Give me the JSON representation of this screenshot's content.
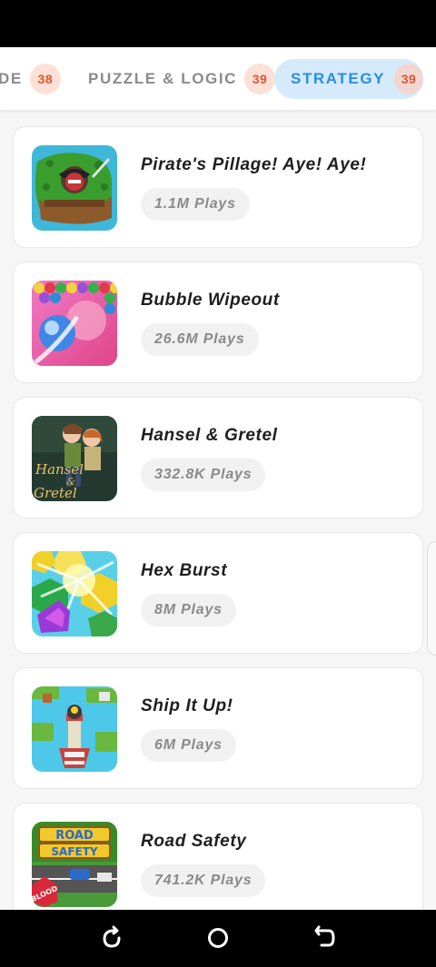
{
  "tabs": [
    {
      "label": "DE",
      "count": "38",
      "active": false
    },
    {
      "label": "PUZZLE & LOGIC",
      "count": "39",
      "active": false
    },
    {
      "label": "STRATEGY",
      "count": "39",
      "active": true
    }
  ],
  "games": [
    {
      "title": "Pirate's Pillage! Aye! Aye!",
      "plays": "1.1M Plays",
      "icon": "pirate-game-icon"
    },
    {
      "title": "Bubble Wipeout",
      "plays": "26.6M Plays",
      "icon": "bubble-game-icon"
    },
    {
      "title": "Hansel & Gretel",
      "plays": "332.8K Plays",
      "icon": "hansel-gretel-game-icon",
      "thumb_text": "Hansel & Gretel"
    },
    {
      "title": "Hex Burst",
      "plays": "8M Plays",
      "icon": "hex-burst-game-icon"
    },
    {
      "title": "Ship It Up!",
      "plays": "6M Plays",
      "icon": "ship-game-icon"
    },
    {
      "title": "Road Safety",
      "plays": "741.2K Plays",
      "icon": "road-safety-game-icon",
      "thumb_text": "ROAD SAFETY BLOOD"
    }
  ],
  "nav": [
    "recent-apps-icon",
    "home-icon",
    "back-icon"
  ],
  "colors": {
    "accent": "#2b8de0",
    "active_tab_bg": "#d5eafb",
    "count_bg": "#fde0d6",
    "count_text": "#e2552e"
  }
}
